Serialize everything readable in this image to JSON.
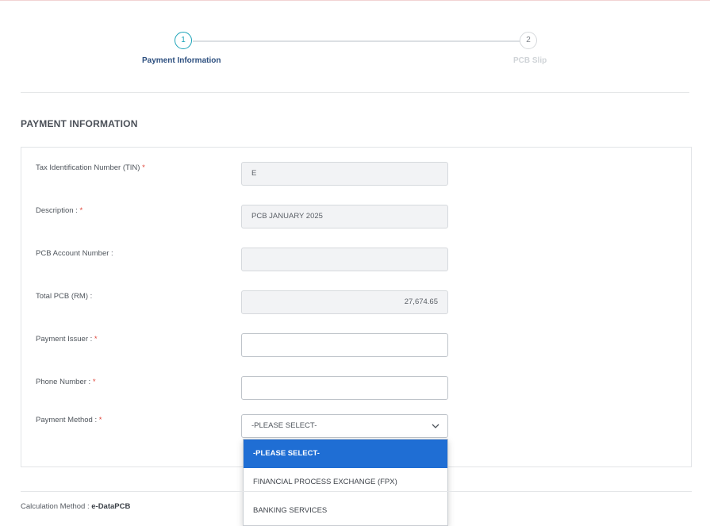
{
  "stepper": {
    "steps": [
      {
        "number": "1",
        "label": "Payment Information",
        "state": "active"
      },
      {
        "number": "2",
        "label": "PCB Slip",
        "state": "inactive"
      }
    ]
  },
  "section": {
    "title": "PAYMENT INFORMATION"
  },
  "form": {
    "tin": {
      "label": "Tax Identification Number (TIN)",
      "required": "*",
      "value": "E"
    },
    "description": {
      "label": "Description :",
      "required": "*",
      "value": "PCB JANUARY 2025"
    },
    "pcb_account": {
      "label": "PCB Account Number :",
      "value": ""
    },
    "total_pcb": {
      "label": "Total PCB (RM) :",
      "value": "27,674.65"
    },
    "payment_issuer": {
      "label": "Payment Issuer :",
      "required": "*",
      "value": ""
    },
    "phone_number": {
      "label": "Phone Number :",
      "required": "*",
      "value": ""
    },
    "payment_method": {
      "label": "Payment Method :",
      "required": "*",
      "selected": "-PLEASE SELECT-",
      "options": [
        "-PLEASE SELECT-",
        "FINANCIAL PROCESS EXCHANGE (FPX)",
        "BANKING SERVICES"
      ]
    }
  },
  "footer": {
    "calc_label": "Calculation Method :",
    "calc_value": "e-DataPCB"
  },
  "colors": {
    "accent": "#1aa3b8",
    "selected_option": "#1f6ed4",
    "required": "#e0463a"
  }
}
